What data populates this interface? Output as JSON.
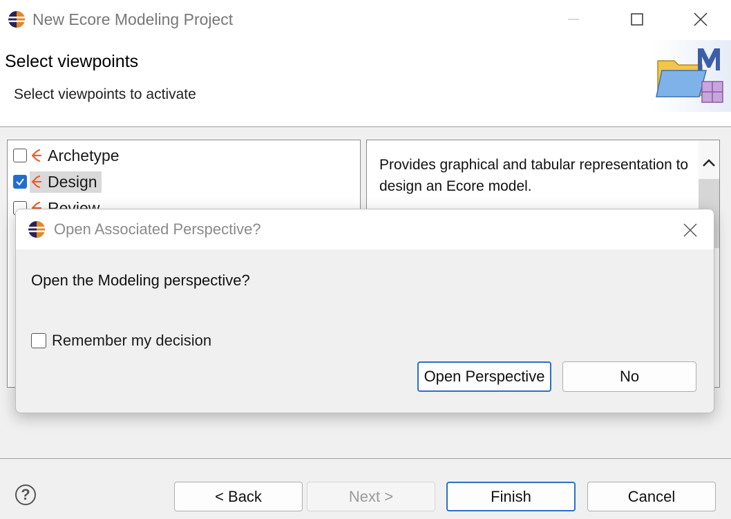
{
  "window": {
    "title": "New Ecore Modeling Project",
    "controls": [
      "minimize-icon",
      "maximize-icon",
      "close-icon"
    ]
  },
  "header": {
    "page_title": "Select viewpoints",
    "page_description": "Select viewpoints to activate"
  },
  "viewpoints": [
    {
      "label": "Archetype",
      "checked": false,
      "selected": false
    },
    {
      "label": "Design",
      "checked": true,
      "selected": true
    },
    {
      "label": "Review",
      "checked": false,
      "selected": false
    }
  ],
  "description": {
    "text": "Provides graphical and tabular representation to design an Ecore model."
  },
  "footer": {
    "back_label": "< Back",
    "next_label": "Next >",
    "finish_label": "Finish",
    "cancel_label": "Cancel"
  },
  "dialog": {
    "title": "Open Associated Perspective?",
    "message": "Open the Modeling perspective?",
    "remember_label": "Remember my decision",
    "remember_checked": false,
    "open_label": "Open Perspective",
    "no_label": "No"
  },
  "colors": {
    "accent": "#2a6fc9",
    "checkbox_checked": "#1f6fd0",
    "viewpoint_icon": "#e8602c"
  }
}
